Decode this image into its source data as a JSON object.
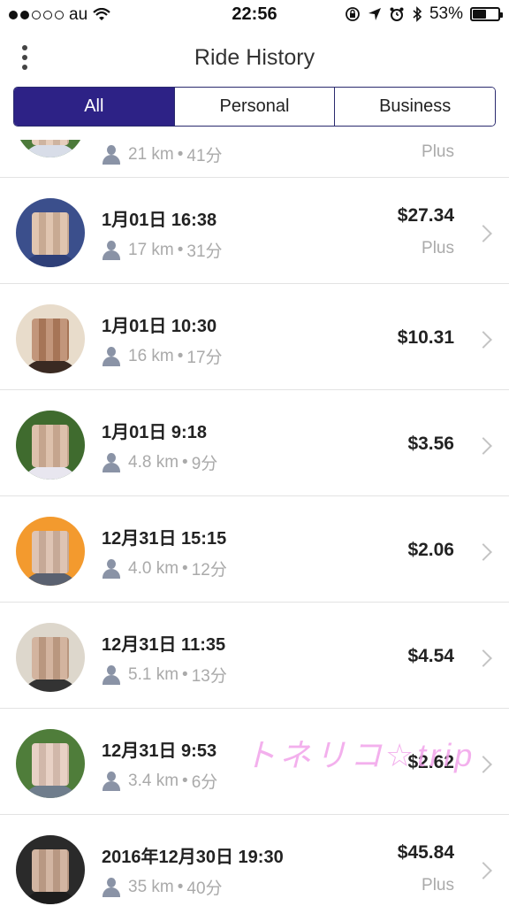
{
  "status_bar": {
    "carrier": "au",
    "time": "22:56",
    "battery": "53%",
    "battery_level": 0.53
  },
  "header": {
    "title": "Ride History",
    "menu_icon": "more-vertical-icon"
  },
  "segments": [
    {
      "label": "All",
      "active": true
    },
    {
      "label": "Personal",
      "active": false
    },
    {
      "label": "Business",
      "active": false
    }
  ],
  "rides": [
    {
      "date": "",
      "distance": "21 km",
      "duration": "41分",
      "price": "",
      "tier": "Plus",
      "avatar_bg": "#4c7a3a",
      "avatar_face": "#e0c3ae",
      "avatar_body": "#d8dde8"
    },
    {
      "date": "1月01日 16:38",
      "distance": "17 km",
      "duration": "31分",
      "price": "$27.34",
      "tier": "Plus",
      "avatar_bg": "#3b4f8c",
      "avatar_face": "#d9b89f",
      "avatar_body": "#2e3f78"
    },
    {
      "date": "1月01日 10:30",
      "distance": "16 km",
      "duration": "17分",
      "price": "$10.31",
      "tier": "",
      "avatar_bg": "#e8dccb",
      "avatar_face": "#b47f5e",
      "avatar_body": "#3a2a22"
    },
    {
      "date": "1月01日 9:18",
      "distance": "4.8 km",
      "duration": "9分",
      "price": "$3.56",
      "tier": "",
      "avatar_bg": "#3f6b2e",
      "avatar_face": "#d6b39a",
      "avatar_body": "#e8e6ef"
    },
    {
      "date": "12月31日 15:15",
      "distance": "4.0 km",
      "duration": "12分",
      "price": "$2.06",
      "tier": "",
      "avatar_bg": "#f39a2e",
      "avatar_face": "#d7b7a4",
      "avatar_body": "#5a6170"
    },
    {
      "date": "12月31日 11:35",
      "distance": "5.1 km",
      "duration": "13分",
      "price": "$4.54",
      "tier": "",
      "avatar_bg": "#ddd7cc",
      "avatar_face": "#c9a48a",
      "avatar_body": "#333333"
    },
    {
      "date": "12月31日 9:53",
      "distance": "3.4 km",
      "duration": "6分",
      "price": "$2.62",
      "tier": "",
      "avatar_bg": "#4f7d3a",
      "avatar_face": "#e3c7b8",
      "avatar_body": "#6f7d8c"
    },
    {
      "date": "2016年12月30日 19:30",
      "distance": "35 km",
      "duration": "40分",
      "price": "$45.84",
      "tier": "Plus",
      "avatar_bg": "#2a2a2a",
      "avatar_face": "#c8a58e",
      "avatar_body": "#1d1d1d"
    }
  ],
  "separator": "•",
  "watermark": "トネリコ☆trip",
  "colors": {
    "accent": "#2d2286",
    "secondary_text": "#aaaaaa",
    "chevron": "#c4c4c4"
  }
}
